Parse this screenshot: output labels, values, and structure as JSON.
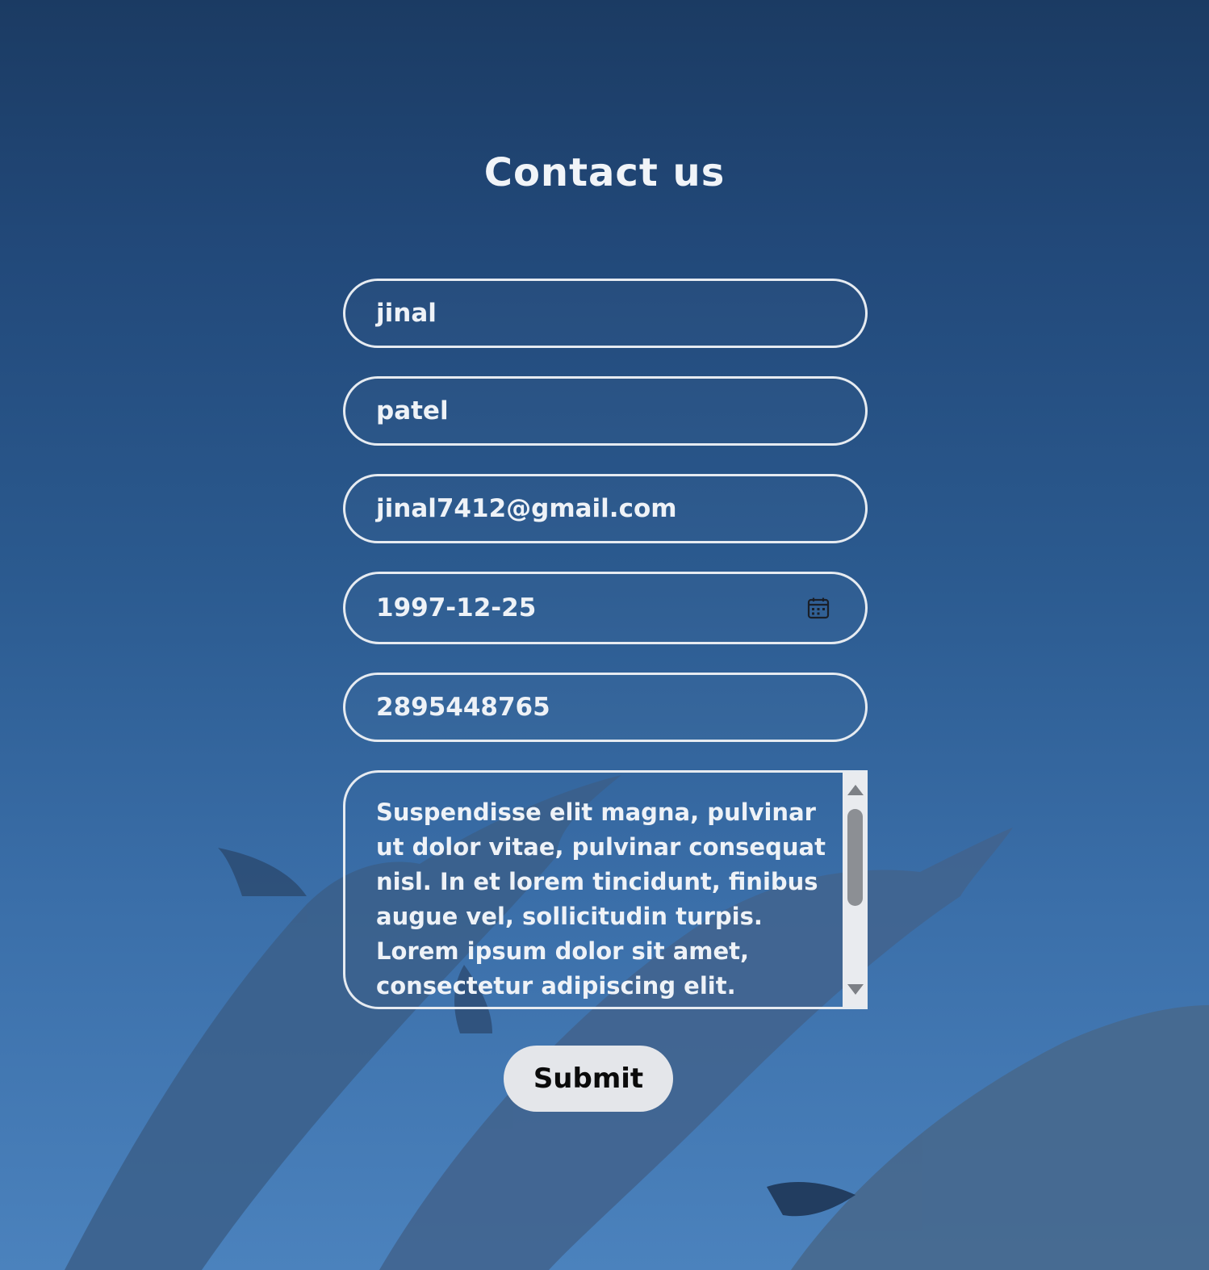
{
  "page": {
    "title": "Contact us"
  },
  "form": {
    "first_name": "jinal",
    "last_name": "patel",
    "email": "jinal7412@gmail.com",
    "date": "1997-12-25",
    "phone": "2895448765",
    "message": "Suspendisse elit magna, pulvinar ut dolor vitae, pulvinar consequat nisl. In et lorem tincidunt, finibus augue vel, sollicitudin turpis. Lorem ipsum dolor sit amet, consectetur adipiscing elit.",
    "submit_label": "Submit"
  },
  "icons": {
    "date_picker": "calendar-icon",
    "scroll_up": "arrow-up-icon",
    "scroll_down": "arrow-down-icon"
  },
  "colors": {
    "background_top": "#1b3b63",
    "background_bottom": "#4b82bd",
    "field_border": "#e6ebf1",
    "text": "#eef2f7",
    "button_bg": "#e4e6ea",
    "button_text": "#0b0b0b"
  }
}
